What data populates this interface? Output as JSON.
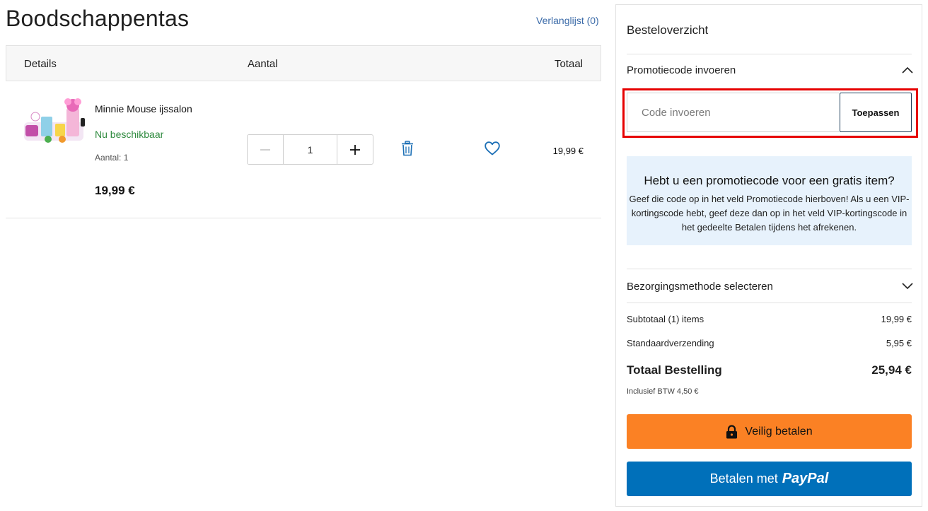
{
  "page": {
    "title": "Boodschappentas",
    "wishlist_link": "Verlanglijst (0)"
  },
  "table": {
    "headers": {
      "details": "Details",
      "quantity": "Aantal",
      "total": "Totaal"
    }
  },
  "item": {
    "name": "Minnie Mouse ijssalon",
    "availability": "Nu beschikbaar",
    "quantity_label": "Aantal: 1",
    "price": "19,99 €",
    "quantity_value": "1",
    "row_total": "19,99 €",
    "icons": {
      "minus": "minus-icon",
      "plus": "plus-icon",
      "delete": "trash-icon",
      "wishlist": "heart-icon"
    }
  },
  "summary": {
    "title": "Besteloverzicht",
    "promo": {
      "header": "Promotiecode invoeren",
      "placeholder": "Code invoeren",
      "value": "",
      "apply_label": "Toepassen"
    },
    "info": {
      "title": "Hebt u een promotiecode voor een gratis item?",
      "text": "Geef die code op in het veld Promotiecode hierboven! Als u een VIP-kortingscode hebt, geef deze dan op in het veld VIP-kortingscode in het gedeelte Betalen tijdens het afrekenen."
    },
    "delivery_header": "Bezorgingsmethode selecteren",
    "subtotal": {
      "label": "Subtotaal (1) items",
      "value": "19,99 €"
    },
    "shipping": {
      "label": "Standaardverzending",
      "value": "5,95 €"
    },
    "total": {
      "label": "Totaal Bestelling",
      "value": "25,94 €"
    },
    "vat_note": "Inclusief BTW 4,50 €",
    "pay_button": "Veilig betalen",
    "paypal_button": {
      "prefix": "Betalen met",
      "brand": "PayPal"
    }
  },
  "colors": {
    "accent_link": "#3a6aa8",
    "availability_green": "#2e8a3e",
    "highlight_red": "#e60000",
    "pay_orange": "#fb8124",
    "paypal_blue": "#0070ba",
    "info_bg": "#e7f2fc",
    "icon_blue": "#1a6eb5"
  }
}
